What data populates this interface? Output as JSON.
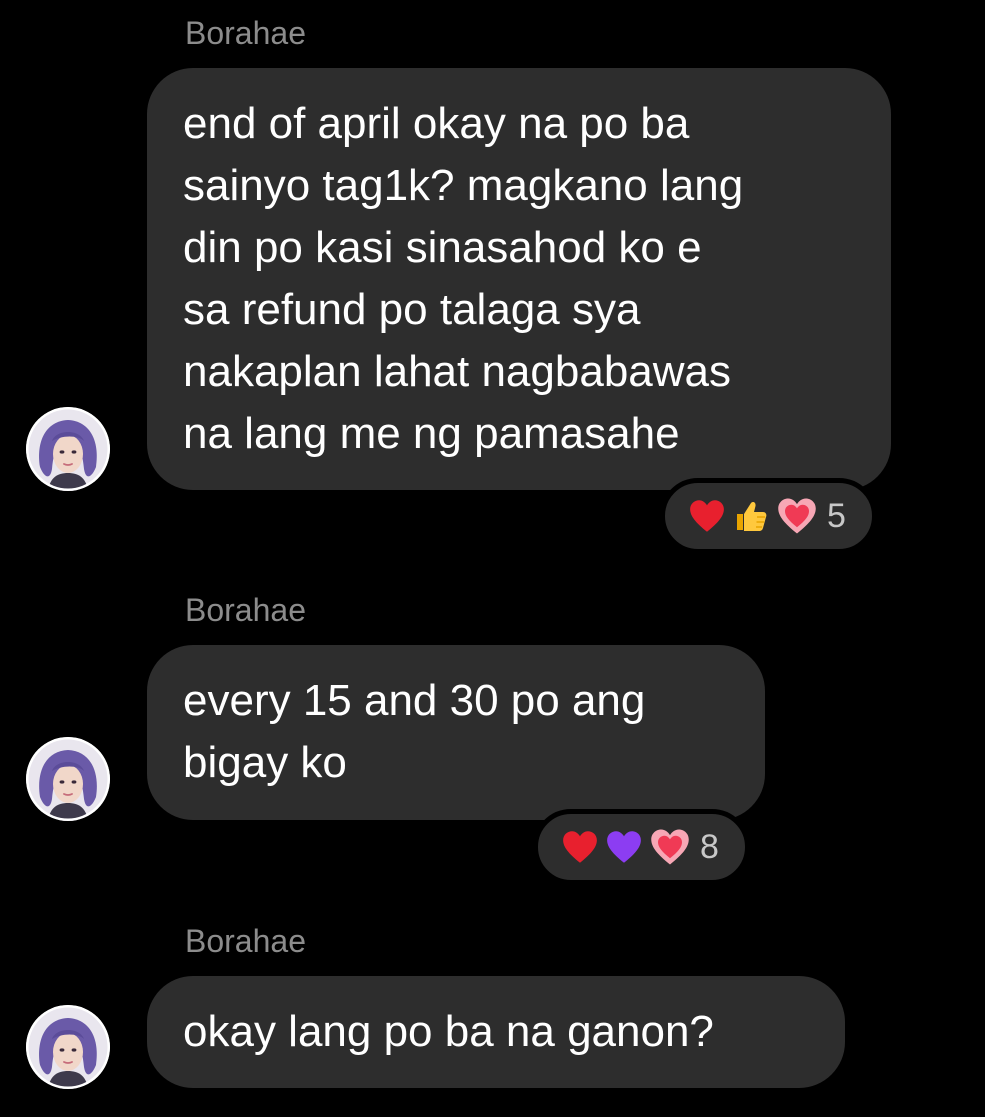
{
  "colors": {
    "background": "#000000",
    "bubble": "#2d2d2d",
    "sender_name": "#8c8c8c",
    "message_text": "#ffffff",
    "reaction_count": "#c8c8c8"
  },
  "messages": [
    {
      "sender": "Borahae",
      "lines": [
        "end of april okay na po ba",
        "sainyo tag1k? magkano lang",
        "din po kasi sinasahod ko e",
        "sa refund po talaga sya",
        "nakaplan lahat nagbabawas",
        "na lang me ng pamasahe"
      ],
      "reactions": {
        "icons": [
          "red-heart-icon",
          "thumbs-up-icon",
          "pink-heart-icon"
        ],
        "count": "5"
      }
    },
    {
      "sender": "Borahae",
      "lines": [
        "every 15 and 30 po ang",
        "bigay ko"
      ],
      "reactions": {
        "icons": [
          "red-heart-icon",
          "purple-heart-icon",
          "pink-heart-icon"
        ],
        "count": "8"
      }
    },
    {
      "sender": "Borahae",
      "lines": [
        "okay lang po ba na ganon?"
      ]
    }
  ]
}
